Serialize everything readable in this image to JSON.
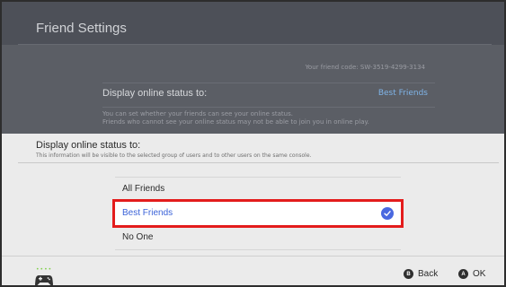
{
  "background": {
    "title": "Friend Settings",
    "friend_code": "Your friend code: SW-3519-4299-3134",
    "row_label": "Display online status to:",
    "row_value": "Best Friends",
    "desc_line1": "You can set whether your friends can see your online status.",
    "desc_line2": "Friends who cannot see your online status may not be able to join you in online play."
  },
  "sheet": {
    "title": "Display online status to:",
    "subtitle": "This information will be visible to the selected group of users and to other users on the same console.",
    "options": [
      {
        "label": "All Friends",
        "selected": false
      },
      {
        "label": "Best Friends",
        "selected": true
      },
      {
        "label": "No One",
        "selected": false
      }
    ]
  },
  "footer": {
    "controller_icon": "controller-icon",
    "back_button": "B",
    "back_label": "Back",
    "ok_button": "A",
    "ok_label": "OK"
  },
  "colors": {
    "highlight_border": "#e31c1c",
    "selected_text": "#3a62d8",
    "check_bg": "#4a68e0"
  }
}
